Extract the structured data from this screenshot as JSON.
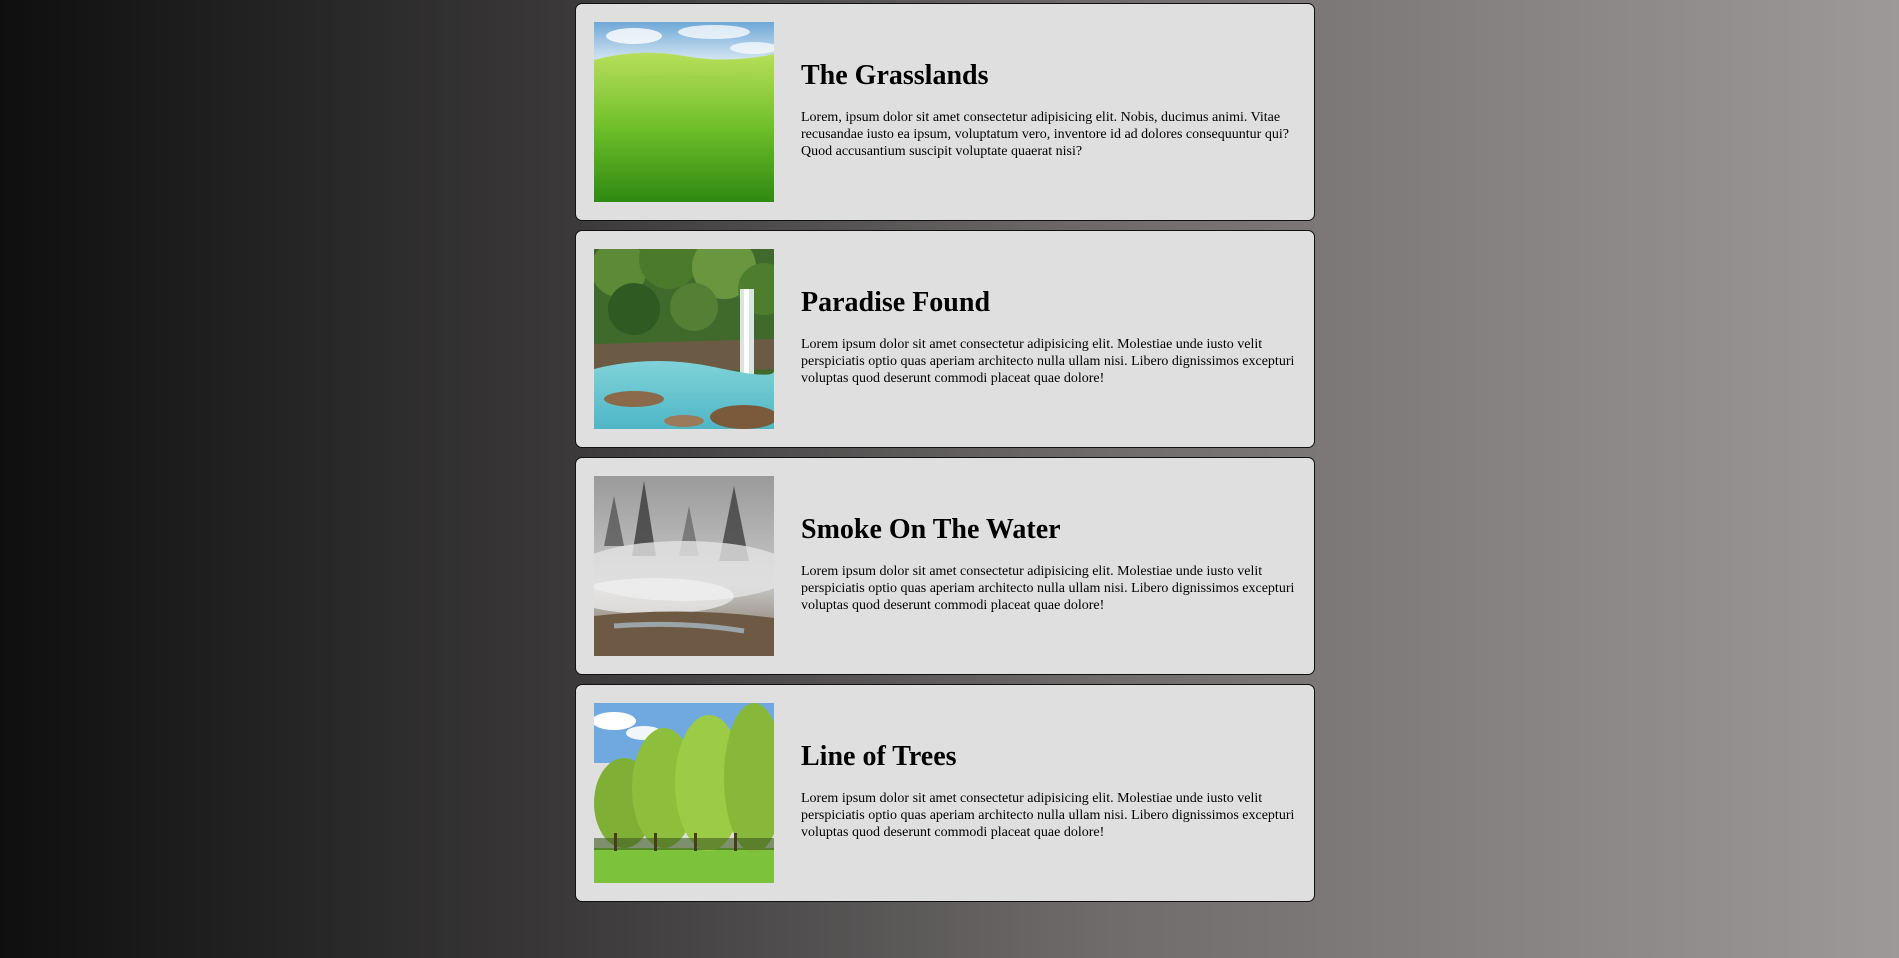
{
  "cards": [
    {
      "title": "The Grasslands",
      "description": "Lorem, ipsum dolor sit amet consectetur adipisicing elit. Nobis, ducimus animi. Vitae recusandae iusto ea ipsum, voluptatum vero, inventore id ad dolores consequuntur qui? Quod accusantium suscipit voluptate quaerat nisi?",
      "image": "grassland-image"
    },
    {
      "title": "Paradise Found",
      "description": "Lorem ipsum dolor sit amet consectetur adipisicing elit. Molestiae unde iusto velit perspiciatis optio quas aperiam architecto nulla ullam nisi. Libero dignissimos excepturi voluptas quod deserunt commodi placeat quae dolore!",
      "image": "waterfall-image"
    },
    {
      "title": "Smoke On The Water",
      "description": "Lorem ipsum dolor sit amet consectetur adipisicing elit. Molestiae unde iusto velit perspiciatis optio quas aperiam architecto nulla ullam nisi. Libero dignissimos excepturi voluptas quod deserunt commodi placeat quae dolore!",
      "image": "misty-water-image"
    },
    {
      "title": "Line of Trees",
      "description": "Lorem ipsum dolor sit amet consectetur adipisicing elit. Molestiae unde iusto velit perspiciatis optio quas aperiam architecto nulla ullam nisi. Libero dignissimos excepturi voluptas quod deserunt commodi placeat quae dolore!",
      "image": "tree-line-image"
    }
  ],
  "colors": {
    "card_background": "#dfdfdf",
    "card_border": "#111111",
    "background_left": "#0f0f0f",
    "background_right": "#9d9999"
  }
}
